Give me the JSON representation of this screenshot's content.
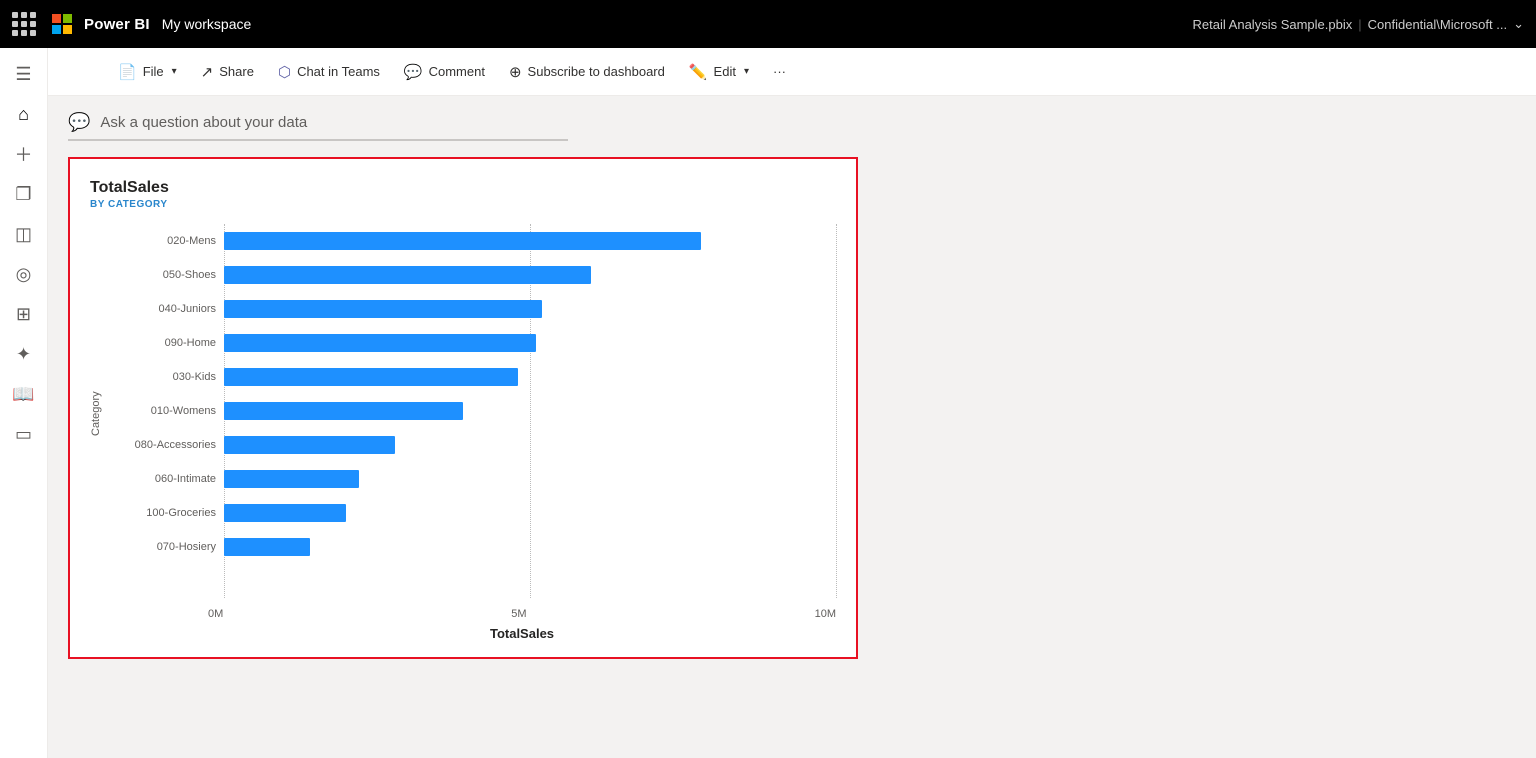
{
  "topbar": {
    "brand": "Power BI",
    "workspace": "My workspace",
    "file_info": "Retail Analysis Sample.pbix",
    "confidential": "Confidential\\Microsoft ...",
    "chevron": "⌄"
  },
  "toolbar": {
    "file_label": "File",
    "share_label": "Share",
    "chat_label": "Chat in Teams",
    "comment_label": "Comment",
    "subscribe_label": "Subscribe to dashboard",
    "edit_label": "Edit",
    "more_label": "···"
  },
  "sidebar": {
    "items": [
      {
        "name": "hamburger-menu",
        "icon": "☰"
      },
      {
        "name": "home",
        "icon": "⌂"
      },
      {
        "name": "create",
        "icon": "+"
      },
      {
        "name": "browse",
        "icon": "❏"
      },
      {
        "name": "data",
        "icon": "⬛"
      },
      {
        "name": "goals",
        "icon": "◎"
      },
      {
        "name": "apps",
        "icon": "⊞"
      },
      {
        "name": "learn",
        "icon": "🚀"
      },
      {
        "name": "book",
        "icon": "📖"
      },
      {
        "name": "monitor",
        "icon": "🖥"
      }
    ]
  },
  "ask_bar": {
    "icon": "💬",
    "placeholder": "Ask a question about your data"
  },
  "chart": {
    "title": "TotalSales",
    "subtitle": "BY CATEGORY",
    "y_axis_label": "Category",
    "x_axis_label": "TotalSales",
    "x_ticks": [
      "0M",
      "5M",
      "10M"
    ],
    "bars": [
      {
        "label": "020-Mens",
        "value": 78
      },
      {
        "label": "050-Shoes",
        "value": 60
      },
      {
        "label": "040-Juniors",
        "value": 52
      },
      {
        "label": "090-Home",
        "value": 51
      },
      {
        "label": "030-Kids",
        "value": 48
      },
      {
        "label": "010-Womens",
        "value": 39
      },
      {
        "label": "080-Accessories",
        "value": 28
      },
      {
        "label": "060-Intimate",
        "value": 22
      },
      {
        "label": "100-Groceries",
        "value": 20
      },
      {
        "label": "070-Hosiery",
        "value": 14
      }
    ],
    "grid_lines": [
      0,
      50,
      100
    ]
  }
}
